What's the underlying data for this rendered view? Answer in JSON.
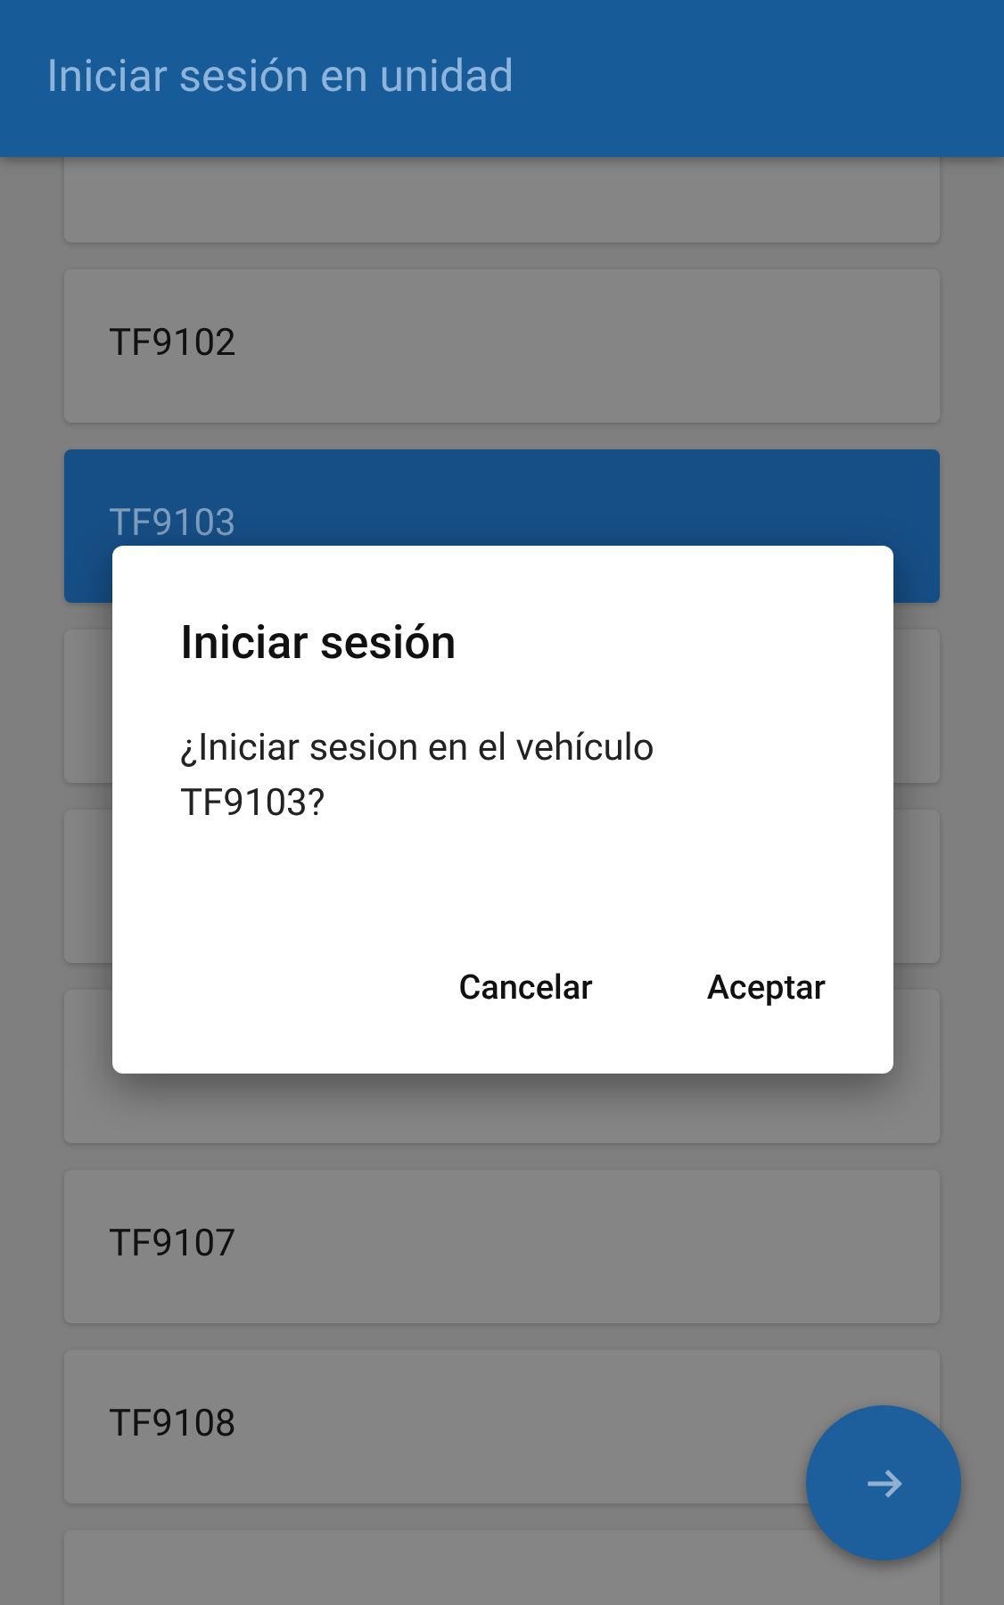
{
  "app_bar": {
    "title": "Iniciar sesión en unidad"
  },
  "units": [
    {
      "selected": false
    },
    {
      "label": "TF9102",
      "selected": false
    },
    {
      "label": "TF9103",
      "selected": true
    },
    {
      "selected": false
    },
    {
      "selected": false
    },
    {
      "selected": false
    },
    {
      "label": "TF9107",
      "selected": false
    },
    {
      "label": "TF9108",
      "selected": false
    },
    {
      "selected": false
    }
  ],
  "dialog": {
    "title": "Iniciar sesión",
    "message": "¿Iniciar sesion en el vehículo TF9103?",
    "buttons": [
      "Cancelar",
      "Aceptar"
    ]
  }
}
